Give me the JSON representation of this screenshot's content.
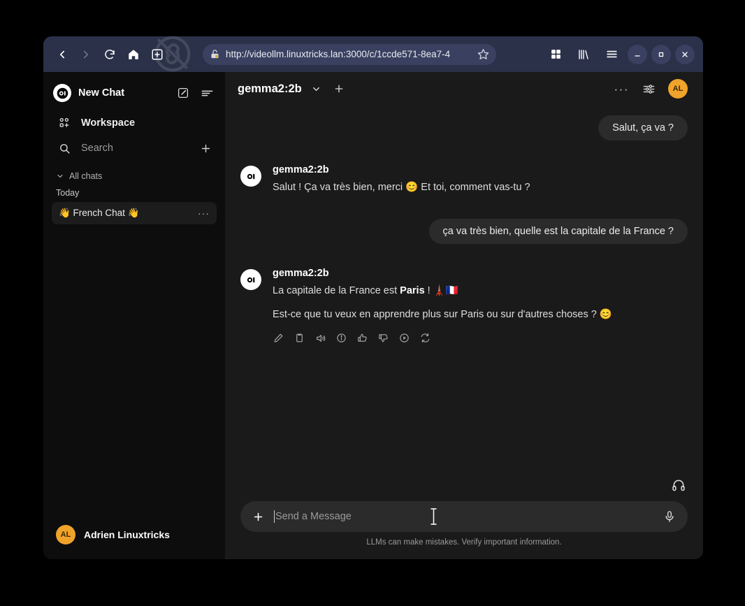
{
  "browser": {
    "back_label": "Back",
    "forward_label": "Forward",
    "reload_label": "Reload",
    "home_label": "Home",
    "newtab_label": "New Tab",
    "url": "http://videollm.linuxtricks.lan:3000/c/1ccde571-8ea7-4",
    "bookmark_label": "Bookmark",
    "extensions_label": "Extensions",
    "library_label": "Library",
    "menu_label": "Open Menu",
    "minimize_label": "Minimize",
    "maximize_label": "Maximize",
    "close_label": "Close",
    "toolbar_color": "#2a3148",
    "urlbar_color": "#3a4160"
  },
  "sidebar": {
    "new_chat_label": "New Chat",
    "edit_icon_label": "New Chat",
    "toggle_icon_label": "Toggle Sidebar",
    "workspace_label": "Workspace",
    "search_label": "Search",
    "search_add_label": "New Chat",
    "all_chats_label": "All chats",
    "day_label": "Today",
    "chats": [
      {
        "title": "👋 French Chat 👋",
        "menu": "···"
      }
    ],
    "user": {
      "initials": "AL",
      "name": "Adrien Linuxtricks",
      "avatar_color": "#f0a32a"
    },
    "background": "#0d0d0d"
  },
  "header": {
    "model": "gemma2:2b",
    "chevron": "chevron-down",
    "add_model_label": "+",
    "more_label": "···",
    "controls_label": "Chat Controls",
    "avatar_initials": "AL"
  },
  "conversation": [
    {
      "role": "user",
      "text": "Salut, ça va ?"
    },
    {
      "role": "assistant",
      "name": "gemma2:2b",
      "paragraphs": [
        {
          "pre": "Salut ! Ça va très bien, merci 😊 Et toi, comment vas-tu ?",
          "bold": "",
          "post": ""
        }
      ],
      "actions": []
    },
    {
      "role": "user",
      "text": "ça va très bien, quelle est la capitale de la France ?"
    },
    {
      "role": "assistant",
      "name": "gemma2:2b",
      "paragraphs": [
        {
          "pre": "La capitale de la France est ",
          "bold": "Paris",
          "post": " ! 🗼🇫🇷"
        },
        {
          "pre": "Est-ce que tu veux en apprendre plus sur Paris ou sur d'autres choses ? 😊",
          "bold": "",
          "post": ""
        }
      ],
      "actions": [
        "edit-icon",
        "copy-icon",
        "speaker-icon",
        "info-icon",
        "thumbs-up-icon",
        "thumbs-down-icon",
        "continue-icon",
        "regenerate-icon"
      ]
    }
  ],
  "composer": {
    "add_label": "+",
    "placeholder": "Send a Message",
    "value": "",
    "mic_label": "Voice Input",
    "call_label": "Call",
    "disclaimer": "LLMs can make mistakes. Verify important information."
  },
  "theme": {
    "page_background": "#000000",
    "main_background": "#1a1a1a",
    "bubble_background": "#2b2b2b",
    "accent": "#f0a32a"
  }
}
